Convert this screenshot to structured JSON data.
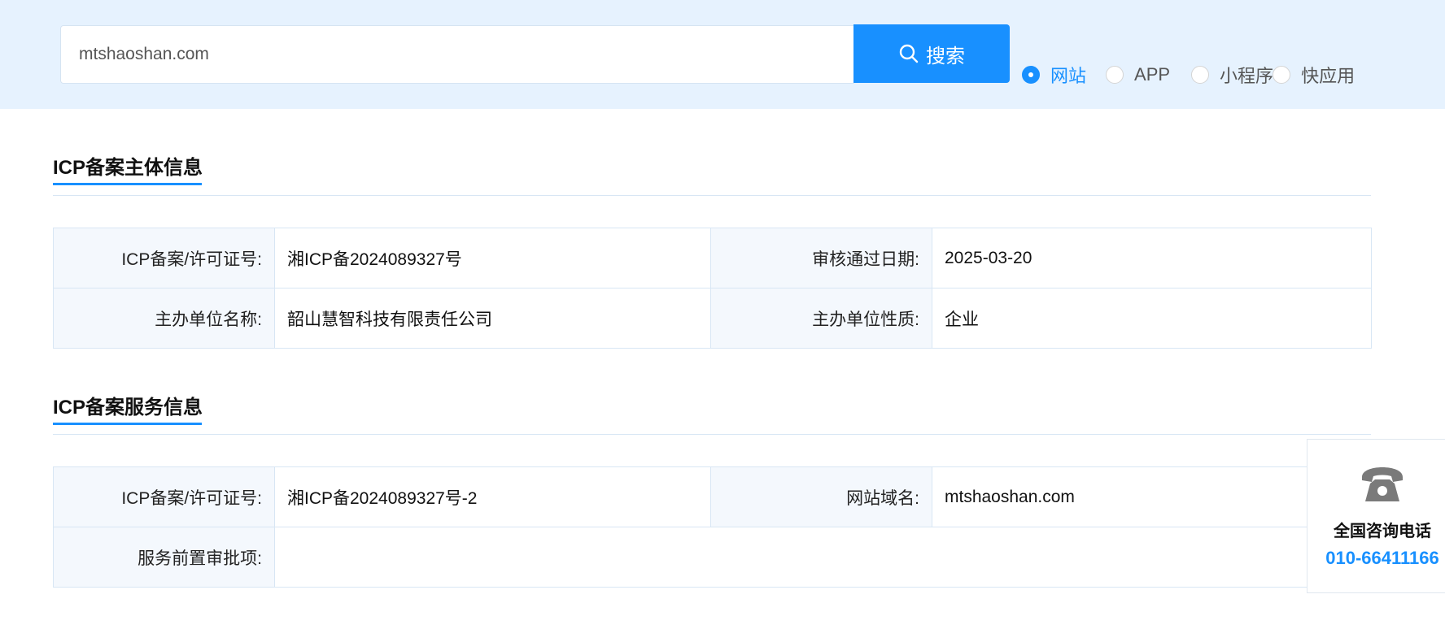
{
  "search": {
    "query": "mtshaoshan.com",
    "button_label": "搜索"
  },
  "types": {
    "web": "网站",
    "app": "APP",
    "mini": "小程序",
    "quick": "快应用",
    "selected": "网站"
  },
  "section1": {
    "title": "ICP备案主体信息",
    "license_label": "ICP备案/许可证号:",
    "license_value": "湘ICP备2024089327号",
    "date_label": "审核通过日期:",
    "date_value": "2025-03-20",
    "org_label": "主办单位名称:",
    "org_value": "韶山慧智科技有限责任公司",
    "nature_label": "主办单位性质:",
    "nature_value": "企业"
  },
  "section2": {
    "title": "ICP备案服务信息",
    "license_label": "ICP备案/许可证号:",
    "license_value": "湘ICP备2024089327号-2",
    "domain_label": "网站域名:",
    "domain_value": "mtshaoshan.com",
    "approval_label": "服务前置审批项:",
    "approval_value": ""
  },
  "consult": {
    "title": "全国咨询电话",
    "phone": "010-66411166"
  },
  "colors": {
    "accent": "#1890ff",
    "band": "#e6f2fe",
    "label_bg": "#f4f8fd",
    "border": "#d8e6f4"
  },
  "icons": {
    "search": "search-icon",
    "phone": "phone-icon"
  }
}
